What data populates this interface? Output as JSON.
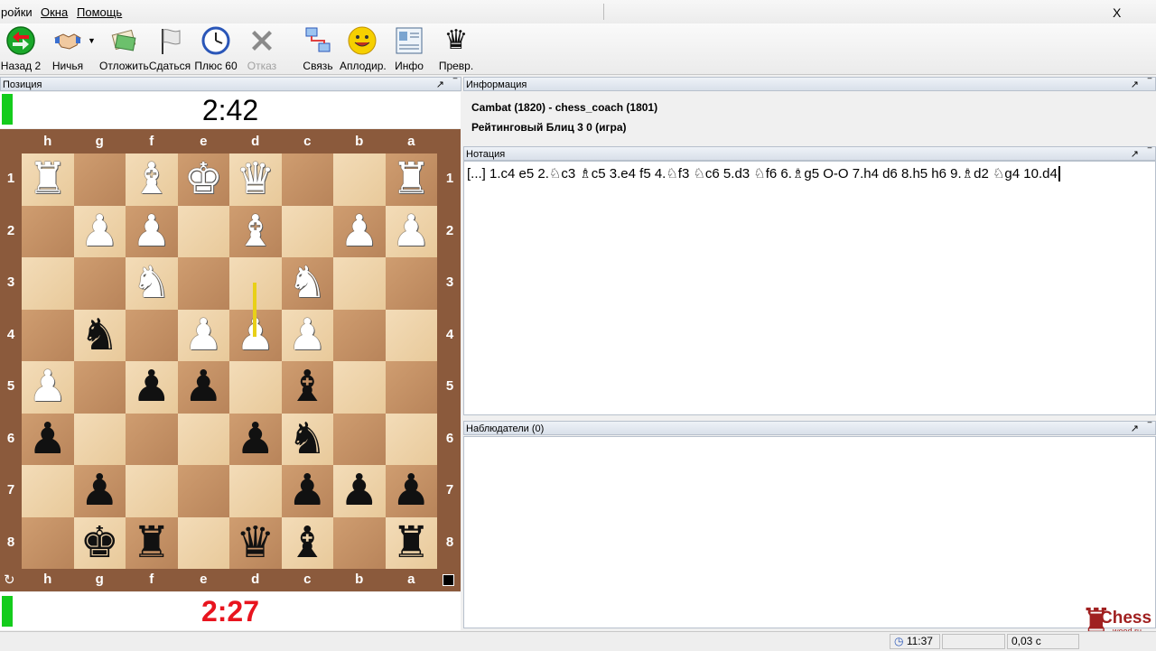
{
  "menu": [
    "ройки",
    "Окна",
    "Помощь"
  ],
  "window_close": "X",
  "toolbar": [
    {
      "label": "Назад 2",
      "icon": "back-arrow-icon",
      "disabled": false
    },
    {
      "label": "Ничья",
      "icon": "handshake-icon",
      "disabled": false
    },
    {
      "label": "Отложить",
      "icon": "adjourn-icon",
      "disabled": false
    },
    {
      "label": "Сдаться",
      "icon": "flag-icon",
      "disabled": false
    },
    {
      "label": "Плюс 60",
      "icon": "clock-icon",
      "disabled": false
    },
    {
      "label": "Отказ",
      "icon": "cross-icon",
      "disabled": true
    },
    {
      "label": "Связь",
      "icon": "network-icon",
      "disabled": false
    },
    {
      "label": "Аплодир.",
      "icon": "smiley-icon",
      "disabled": false
    },
    {
      "label": "Инфо",
      "icon": "info-card-icon",
      "disabled": false
    },
    {
      "label": "Превр.",
      "icon": "queen-promote-icon",
      "disabled": false
    }
  ],
  "position_panel": {
    "title": "Позиция",
    "top_clock": "2:42",
    "bottom_clock": "2:27",
    "bottom_clock_color": "#e8141e",
    "flag_color": "#14cc1c",
    "files": [
      "h",
      "g",
      "f",
      "e",
      "d",
      "c",
      "b",
      "a"
    ],
    "ranks": [
      "1",
      "2",
      "3",
      "4",
      "5",
      "6",
      "7",
      "8"
    ],
    "rows": [
      [
        "wR",
        "",
        "wB",
        "wK",
        "wQ",
        "",
        "",
        "wR"
      ],
      [
        "",
        "wP",
        "wP",
        "",
        "wB",
        "",
        "wP",
        "wP"
      ],
      [
        "",
        "",
        "wN",
        "",
        "",
        "wN",
        "",
        ""
      ],
      [
        "",
        "bN",
        "",
        "wP",
        "wP",
        "wP",
        "",
        ""
      ],
      [
        "wP",
        "",
        "bP",
        "bP",
        "",
        "bB",
        "",
        ""
      ],
      [
        "bP",
        "",
        "",
        "",
        "bP",
        "bN",
        "",
        ""
      ],
      [
        "",
        "bP",
        "",
        "",
        "",
        "bP",
        "bP",
        "bP"
      ],
      [
        "",
        "bK",
        "bR",
        "",
        "bQ",
        "bB",
        "",
        "bR"
      ]
    ]
  },
  "info_panel": {
    "title": "Информация",
    "players": "Cambat (1820) - chess_coach (1801)",
    "game_type": "Рейтинговый Блиц 3 0  (игра)"
  },
  "notation_panel": {
    "title": "Нотация",
    "moves": "[...] 1.c4 e5 2.♘c3 ♗c5 3.e4 f5 4.♘f3 ♘c6 5.d3 ♘f6 6.♗g5 O-O 7.h4 d6 8.h5 h6 9.♗d2 ♘g4 10.d4"
  },
  "observers_panel": {
    "title": "Наблюдатели (0)"
  },
  "status_bar": {
    "time": "11:37",
    "lag": "0,03 с"
  },
  "logo": {
    "name": "Chess",
    "sub": "wood.ru"
  }
}
